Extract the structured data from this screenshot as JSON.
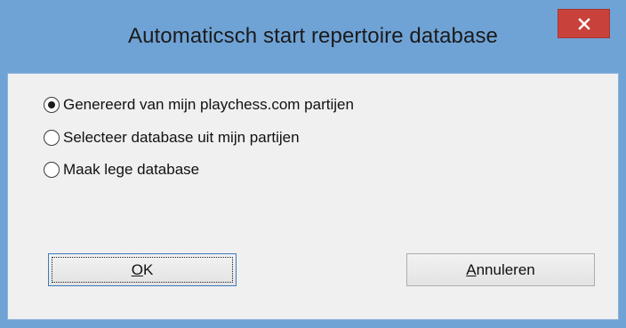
{
  "window": {
    "title": "Automaticsch start repertoire database",
    "close_icon": "close-icon"
  },
  "options": [
    {
      "label": "Genereerd van mijn playchess.com partijen",
      "checked": true
    },
    {
      "label": "Selecteer database uit mijn partijen",
      "checked": false
    },
    {
      "label": "Maak lege database",
      "checked": false
    }
  ],
  "buttons": {
    "ok": {
      "accel": "O",
      "rest": "K"
    },
    "cancel": {
      "accel": "A",
      "rest": "nnuleren"
    }
  },
  "colors": {
    "title_bar": "#6fa3d6",
    "close_button": "#c8413b",
    "client_background": "#f0f0f0"
  }
}
